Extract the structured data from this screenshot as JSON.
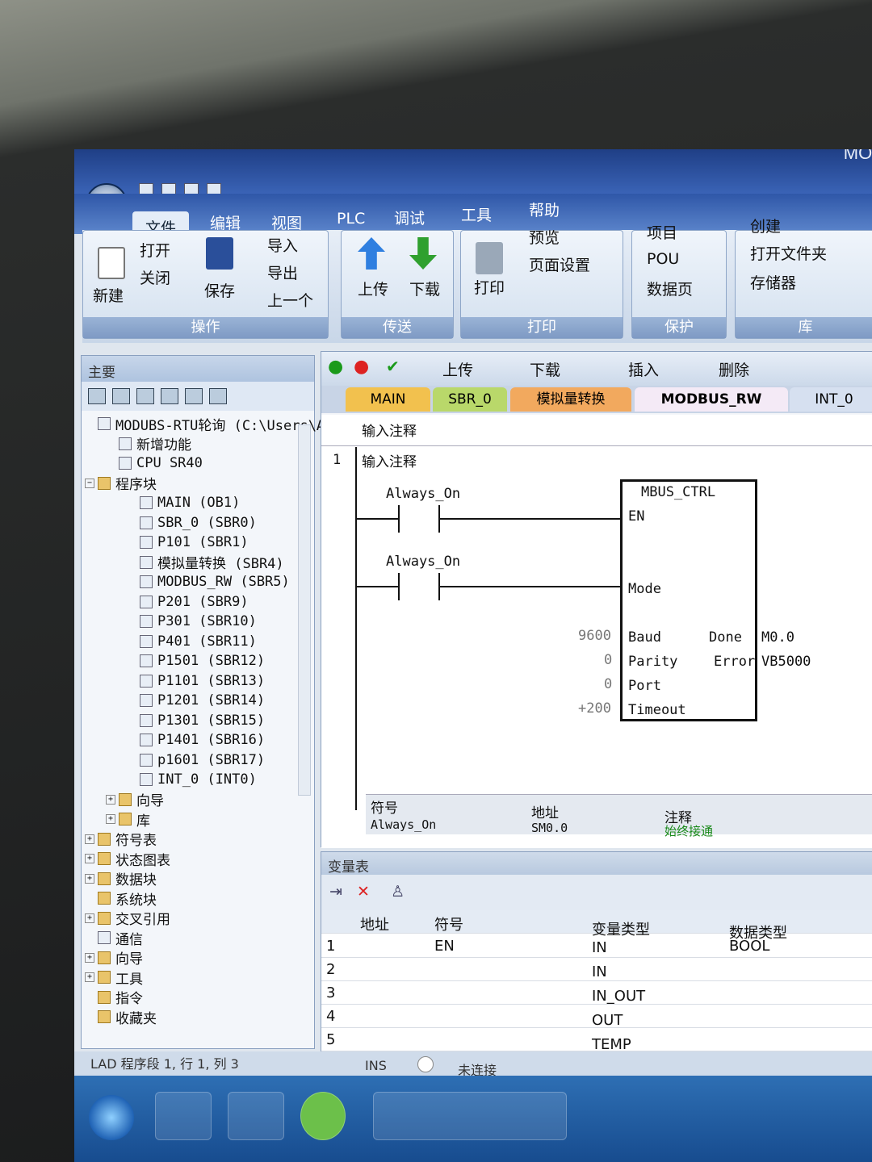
{
  "window": {
    "title": "MODU"
  },
  "menu": [
    "文件",
    "编辑",
    "视图",
    "PLC",
    "调试",
    "工具",
    "帮助"
  ],
  "ribbon": {
    "operate": {
      "label": "操作",
      "new": "新建",
      "open": "打开",
      "close": "关闭",
      "save": "保存",
      "import": "导入",
      "export": "导出",
      "prev": "上一个"
    },
    "transfer": {
      "label": "传送",
      "upload": "上传",
      "download": "下载"
    },
    "print": {
      "label": "打印",
      "print": "打印",
      "preview": "预览",
      "page_setup": "页面设置"
    },
    "protect": {
      "label": "保护",
      "project": "项目",
      "pou": "POU",
      "datapage": "数据页"
    },
    "library": {
      "label": "库",
      "create": "创建",
      "open_folder": "打开文件夹",
      "storage": "存储器"
    }
  },
  "left_panel": {
    "title": "主要",
    "tree": [
      "MODUBS-RTU轮询 (C:\\Users\\A",
      "新增功能",
      "CPU SR40",
      "程序块",
      "MAIN (OB1)",
      "SBR_0 (SBR0)",
      "P101 (SBR1)",
      "模拟量转换 (SBR4)",
      "MODBUS_RW (SBR5)",
      "P201 (SBR9)",
      "P301 (SBR10)",
      "P401 (SBR11)",
      "P1501 (SBR12)",
      "P1101 (SBR13)",
      "P1201 (SBR14)",
      "P1301 (SBR15)",
      "P1401 (SBR16)",
      "p1601 (SBR17)",
      "INT_0 (INT0)",
      "向导",
      "库",
      "符号表",
      "状态图表",
      "数据块",
      "系统块",
      "交叉引用",
      "通信",
      "向导",
      "工具",
      "指令",
      "收藏夹"
    ]
  },
  "editor": {
    "toolbar": {
      "upload": "上传",
      "download": "下载",
      "insert": "插入",
      "delete": "删除"
    },
    "tabs": [
      "MAIN",
      "SBR_0",
      "模拟量转换",
      "MODBUS_RW",
      "INT_0"
    ],
    "comment_header": "输入注释",
    "network_num": "1",
    "network_comment": "输入注释",
    "contact1": "Always_On",
    "contact2": "Always_On",
    "block": {
      "name": "MBUS_CTRL",
      "en": "EN",
      "mode": "Mode",
      "baud": "Baud",
      "parity": "Parity",
      "port": "Port",
      "timeout": "Timeout",
      "done": "Done",
      "error": "Error"
    },
    "params": {
      "baud": "9600",
      "parity": "0",
      "port": "0",
      "timeout": "+200",
      "done": "M0.0",
      "error": "VB5000"
    },
    "symbol_table": {
      "headers": [
        "符号",
        "地址",
        "注释"
      ],
      "row": [
        "Always_On",
        "SM0.0",
        "始终接通"
      ]
    }
  },
  "var_table": {
    "title": "变量表",
    "headers": [
      "地址",
      "符号",
      "变量类型",
      "数据类型"
    ],
    "rows": [
      {
        "n": "1",
        "symbol": "EN",
        "vtype": "IN",
        "dtype": "BOOL"
      },
      {
        "n": "2",
        "symbol": "",
        "vtype": "IN",
        "dtype": ""
      },
      {
        "n": "3",
        "symbol": "",
        "vtype": "IN_OUT",
        "dtype": ""
      },
      {
        "n": "4",
        "symbol": "",
        "vtype": "OUT",
        "dtype": ""
      },
      {
        "n": "5",
        "symbol": "",
        "vtype": "TEMP",
        "dtype": ""
      }
    ]
  },
  "status": {
    "position": "LAD 程序段 1, 行 1, 列 3",
    "mode": "INS",
    "connection": "未连接"
  }
}
